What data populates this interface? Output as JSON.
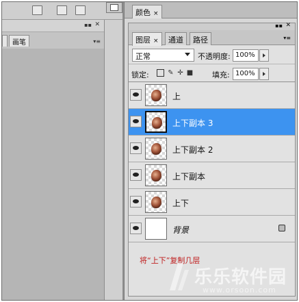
{
  "left_panel": {
    "tab_brushes": "画笔"
  },
  "color_panel": {
    "tab_label": "颜色",
    "close": "×"
  },
  "layers_panel": {
    "tabs": [
      {
        "label": "图层",
        "close": "×",
        "active": true
      },
      {
        "label": "通道"
      },
      {
        "label": "路径"
      }
    ],
    "blend_mode": "正常",
    "opacity_label": "不透明度:",
    "opacity_value": "100%",
    "lock_label": "锁定:",
    "fill_label": "填充:",
    "fill_value": "100%",
    "lock_icons": [
      "lock-transparent-icon",
      "lock-brush-icon",
      "lock-move-icon",
      "lock-all-icon"
    ],
    "layers": [
      {
        "name": "上",
        "selected": false
      },
      {
        "name": "上下副本 3",
        "selected": true
      },
      {
        "name": "上下副本 2",
        "selected": false
      },
      {
        "name": "上下副本",
        "selected": false
      },
      {
        "name": "上下",
        "selected": false
      },
      {
        "name": "背景",
        "selected": false,
        "locked": true,
        "italic": true
      }
    ]
  },
  "annotation": "将“上下”复制几层",
  "watermark": {
    "text": "乐乐软件园",
    "url": "www.orsoon.com"
  },
  "colors": {
    "selection": "#3d93f0",
    "annotation": "#c02020"
  }
}
